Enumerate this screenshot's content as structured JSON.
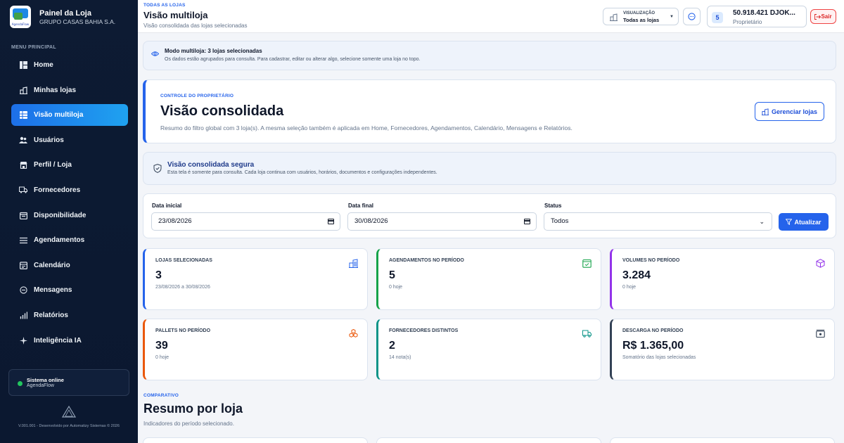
{
  "brand": {
    "title": "Painel da Loja",
    "subtitle": "GRUPO CASAS BAHIA S.A.",
    "logo_text": "AgendaFlow"
  },
  "sidebar": {
    "menu_title": "MENU PRINCIPAL",
    "items": [
      {
        "label": "Home",
        "icon": "home-icon"
      },
      {
        "label": "Minhas lojas",
        "icon": "stores-icon"
      },
      {
        "label": "Visão multiloja",
        "icon": "grid-icon",
        "active": true
      },
      {
        "label": "Usuários",
        "icon": "users-icon"
      },
      {
        "label": "Perfil / Loja",
        "icon": "store-profile-icon"
      },
      {
        "label": "Fornecedores",
        "icon": "truck-icon"
      },
      {
        "label": "Disponibilidade",
        "icon": "calendar-clock-icon"
      },
      {
        "label": "Agendamentos",
        "icon": "list-icon"
      },
      {
        "label": "Calendário",
        "icon": "calendar-icon"
      },
      {
        "label": "Mensagens",
        "icon": "message-icon"
      },
      {
        "label": "Relatórios",
        "icon": "chart-icon"
      },
      {
        "label": "Inteligência IA",
        "icon": "sparkle-icon"
      }
    ],
    "status_title": "Sistema online",
    "status_sub": "AgendaFlow",
    "footer": "V.001.001 - Desenvolvido por Automatizy Sistemas © 2026"
  },
  "topbar": {
    "breadcrumb": "TODAS AS LOJAS",
    "title": "Visão multiloja",
    "subtitle": "Visão consolidada das lojas selecionadas",
    "viz_label": "VISUALIZAÇÃO",
    "viz_value": "Todas as lojas",
    "store_count": "5",
    "user_name": "50.918.421 DJOK...",
    "user_role": "Proprietário",
    "logout": "Sair"
  },
  "notice": {
    "title": "Modo multiloja: 3 lojas selecionadas",
    "text": "Os dados estão agrupados para consulta. Para cadastrar, editar ou alterar algo, selecione somente uma loja no topo."
  },
  "hero": {
    "kicker": "CONTROLE DO PROPRIETÁRIO",
    "title": "Visão consolidada",
    "text": "Resumo do filtro global com 3 loja(s). A mesma seleção também é aplicada em Home, Fornecedores, Agendamentos, Calendário, Mensagens e Relatórios.",
    "button": "Gerenciar lojas"
  },
  "safe": {
    "title": "Visão consolidada segura",
    "text": "Esta tela é somente para consulta. Cada loja continua com usuários, horários, documentos e configurações independentes."
  },
  "filters": {
    "start_label": "Data inicial",
    "start_value": "23/08/2026",
    "end_label": "Data final",
    "end_value": "30/08/2026",
    "status_label": "Status",
    "status_value": "Todos",
    "refresh": "Atualizar"
  },
  "cards": [
    {
      "label": "LOJAS SELECIONADAS",
      "value": "3",
      "sub": "23/08/2026 a 30/08/2026",
      "color": "#2563eb",
      "icon": "building-icon"
    },
    {
      "label": "AGENDAMENTOS NO PERÍODO",
      "value": "5",
      "sub": "0 hoje",
      "color": "#16a34a",
      "icon": "calendar-check-icon"
    },
    {
      "label": "VOLUMES NO PERÍODO",
      "value": "3.284",
      "sub": "0 hoje",
      "color": "#9333ea",
      "icon": "box-icon"
    },
    {
      "label": "PALLETS NO PERÍODO",
      "value": "39",
      "sub": "0 hoje",
      "color": "#ea580c",
      "icon": "boxes-icon"
    },
    {
      "label": "FORNECEDORES DISTINTOS",
      "value": "2",
      "sub": "14 nota(s)",
      "color": "#0d9488",
      "icon": "truck-icon"
    },
    {
      "label": "DESCARGA NO PERÍODO",
      "value": "R$ 1.365,00",
      "sub": "Somatório das lojas selecionadas",
      "color": "#334155",
      "icon": "cash-icon"
    }
  ],
  "summary": {
    "kicker": "COMPARATIVO",
    "title": "Resumo por loja",
    "subtitle": "Indicadores do período selecionado."
  }
}
